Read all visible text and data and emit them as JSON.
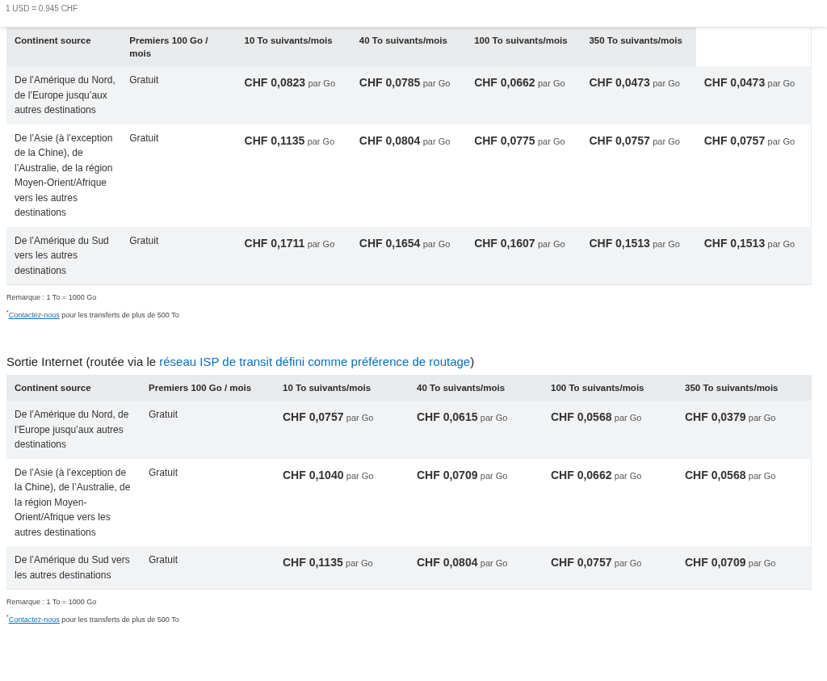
{
  "rate_note": "1 USD = 0.945 CHF",
  "tables": [
    {
      "columns": [
        "Continent source",
        "Premiers 100 Go / mois",
        "10 To suivants/mois",
        "40 To suivants/mois",
        "100 To suivants/mois",
        "350 To suivants/mois"
      ],
      "rows": [
        {
          "source": "De l’Amérique du Nord, de l’Europe jusqu’aux autres destinations",
          "first": "Gratuit",
          "prices": [
            {
              "amount": "CHF 0,0823",
              "unit": "par Go"
            },
            {
              "amount": "CHF 0,0785",
              "unit": "par Go"
            },
            {
              "amount": "CHF 0,0662",
              "unit": "par Go"
            },
            {
              "amount": "CHF 0,0473",
              "unit": "par Go"
            },
            {
              "amount": "CHF 0,0473",
              "unit": "par Go"
            }
          ]
        },
        {
          "source": "De l’Asie (à l’exception de la Chine), de l’Australie, de la région Moyen-Orient/Afrique vers les autres destinations",
          "first": "Gratuit",
          "prices": [
            {
              "amount": "CHF 0,1135",
              "unit": "par Go"
            },
            {
              "amount": "CHF 0,0804",
              "unit": "par Go"
            },
            {
              "amount": "CHF 0,0775",
              "unit": "par Go"
            },
            {
              "amount": "CHF 0,0757",
              "unit": "par Go"
            },
            {
              "amount": "CHF 0,0757",
              "unit": "par Go"
            }
          ]
        },
        {
          "source": "De l’Amérique du Sud vers les autres destinations",
          "first": "Gratuit",
          "prices": [
            {
              "amount": "CHF 0,1711",
              "unit": "par Go"
            },
            {
              "amount": "CHF 0,1654",
              "unit": "par Go"
            },
            {
              "amount": "CHF 0,1607",
              "unit": "par Go"
            },
            {
              "amount": "CHF 0,1513",
              "unit": "par Go"
            },
            {
              "amount": "CHF 0,1513",
              "unit": "par Go"
            }
          ]
        }
      ],
      "remark": "Remarque : 1 To = 1000 Go",
      "contact": {
        "mark": "*",
        "link": "Contactez-nous",
        "text": " pour les transferts de plus de 500 To"
      }
    },
    {
      "heading": {
        "before": "Sortie Internet (routée via le ",
        "link": "réseau ISP de transit défini comme préférence de routage",
        "after": ")"
      },
      "columns": [
        "Continent source",
        "Premiers 100 Go / mois",
        "10 To suivants/mois",
        "40 To suivants/mois",
        "100 To suivants/mois",
        "350 To suivants/mois"
      ],
      "rows": [
        {
          "source": "De l’Amérique du Nord, de l’Europe jusqu’aux autres destinations",
          "first": "Gratuit",
          "prices": [
            {
              "amount": "CHF 0,0757",
              "unit": "par Go"
            },
            {
              "amount": "CHF 0,0615",
              "unit": "par Go"
            },
            {
              "amount": "CHF 0,0568",
              "unit": "par Go"
            },
            {
              "amount": "CHF 0,0379",
              "unit": "par Go"
            }
          ]
        },
        {
          "source": "De l’Asie (à l’exception de la Chine), de l’Australie, de la région Moyen-Orient/Afrique vers les autres destinations",
          "first": "Gratuit",
          "prices": [
            {
              "amount": "CHF 0,1040",
              "unit": "par Go"
            },
            {
              "amount": "CHF 0,0709",
              "unit": "par Go"
            },
            {
              "amount": "CHF 0,0662",
              "unit": "par Go"
            },
            {
              "amount": "CHF 0,0568",
              "unit": "par Go"
            }
          ]
        },
        {
          "source": "De l’Amérique du Sud vers les autres destinations",
          "first": "Gratuit",
          "prices": [
            {
              "amount": "CHF 0,1135",
              "unit": "par Go"
            },
            {
              "amount": "CHF 0,0804",
              "unit": "par Go"
            },
            {
              "amount": "CHF 0,0757",
              "unit": "par Go"
            },
            {
              "amount": "CHF 0,0709",
              "unit": "par Go"
            }
          ]
        }
      ],
      "remark": "Remarque : 1 To = 1000 Go",
      "contact": {
        "mark": "*",
        "link": "Contactez-nous",
        "text": " pour les transferts de plus de 500 To"
      }
    }
  ]
}
